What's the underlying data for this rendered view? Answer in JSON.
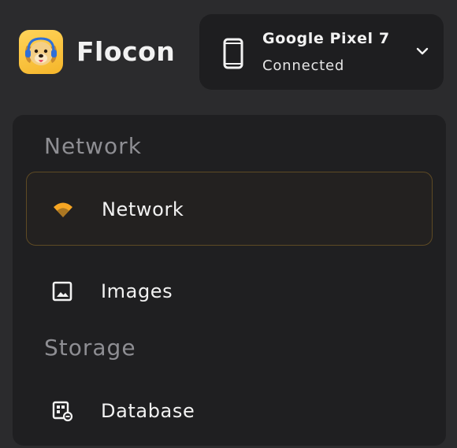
{
  "app": {
    "name": "Flocon",
    "logo_icon": "dog-face-logo-icon",
    "accent": "#f6a623"
  },
  "device": {
    "name": "Google Pixel 7",
    "status": "Connected",
    "icon": "smartphone-icon",
    "dropdown_icon": "chevron-down-icon"
  },
  "sidebar": {
    "sections": [
      {
        "title": "Network",
        "items": [
          {
            "label": "Network",
            "icon": "wifi-icon",
            "active": true
          },
          {
            "label": "Images",
            "icon": "image-icon",
            "active": false
          }
        ]
      },
      {
        "title": "Storage",
        "items": [
          {
            "label": "Database",
            "icon": "database-icon",
            "active": false
          }
        ]
      }
    ]
  }
}
